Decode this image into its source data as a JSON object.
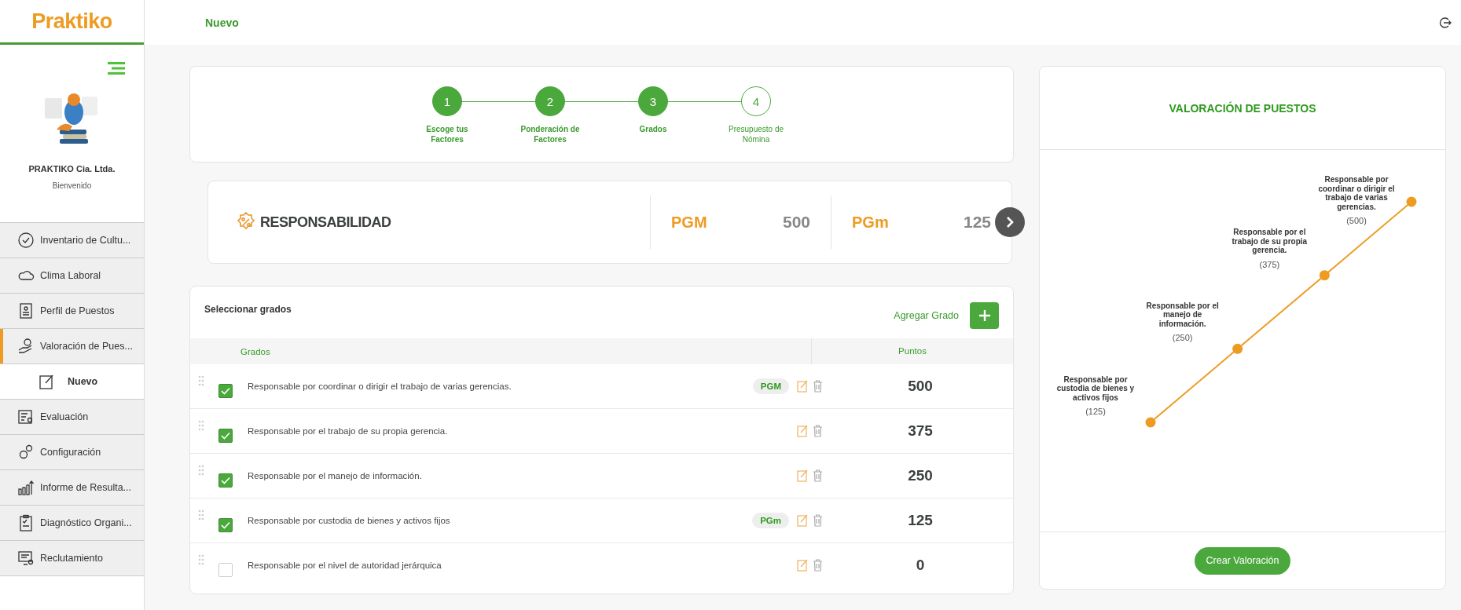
{
  "header": {
    "logo": "Praktiko",
    "page_title": "Nuevo"
  },
  "sidebar": {
    "company": "PRAKTIKO Cia. Ltda.",
    "greeting": "Bienvenido",
    "items": [
      {
        "label": "Inventario de Cultu...",
        "selected": false
      },
      {
        "label": "Clima Laboral",
        "selected": false
      },
      {
        "label": "Perfil de Puestos",
        "selected": false
      },
      {
        "label": "Valoración de Pues...",
        "selected": true,
        "children": [
          {
            "label": "Nuevo",
            "selected": true
          }
        ]
      },
      {
        "label": "Evaluación",
        "selected": false
      },
      {
        "label": "Configuración",
        "selected": false
      },
      {
        "label": "Informe de Resulta...",
        "selected": false
      },
      {
        "label": "Diagnóstico Organi...",
        "selected": false
      },
      {
        "label": "Reclutamiento",
        "selected": false
      }
    ]
  },
  "stepper": {
    "steps": [
      {
        "number": "1",
        "label": "Escoge tus Factores",
        "done": true
      },
      {
        "number": "2",
        "label": "Ponderación de Factores",
        "done": true
      },
      {
        "number": "3",
        "label": "Grados",
        "done": true
      },
      {
        "number": "4",
        "label": "Presupuesto de Nómina",
        "done": false
      }
    ]
  },
  "factor": {
    "name": "RESPONSABILIDAD",
    "stats": [
      {
        "label": "PGM",
        "value": "500"
      },
      {
        "label": "PGm",
        "value": "125"
      }
    ]
  },
  "grades": {
    "title": "Seleccionar grados",
    "add_label": "Agregar Grado",
    "columns": [
      "Grados",
      "Puntos"
    ],
    "rows": [
      {
        "text": "Responsable por coordinar o dirigir el trabajo de varias gerencias.",
        "badge": "PGM",
        "points": "500",
        "checked": true
      },
      {
        "text": "Responsable por el trabajo de su propia gerencia.",
        "points": "375",
        "checked": true
      },
      {
        "text": "Responsable por el manejo de información.",
        "points": "250",
        "checked": true
      },
      {
        "text": "Responsable por custodia de bienes y activos fijos",
        "badge": "PGm",
        "points": "125",
        "checked": true
      },
      {
        "text": "Responsable por el nivel de autoridad jerárquica",
        "points": "0",
        "checked": false
      }
    ]
  },
  "valuation": {
    "title": "VALORACIÓN DE PUESTOS",
    "button": "Crear Valoración",
    "points": [
      {
        "label": "Responsable por custodia de bienes y activos fijos",
        "value": "(125)"
      },
      {
        "label": "Responsable por el manejo de información.",
        "value": "(250)"
      },
      {
        "label": "Responsable por el trabajo de su propia gerencia.",
        "value": "(375)"
      },
      {
        "label": "Responsable por coordinar o dirigir el trabajo de varias gerencias.",
        "value": "(500)"
      }
    ]
  }
}
